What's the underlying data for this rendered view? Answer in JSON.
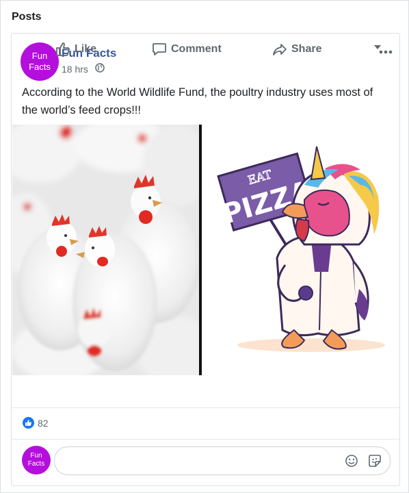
{
  "section": {
    "title": "Posts"
  },
  "post": {
    "avatar_line1": "Fun",
    "avatar_line2": "Facts",
    "author": "Fun Facts",
    "time": "18 hrs",
    "audience_icon": "globe-icon",
    "more_icon": "ellipsis-icon",
    "text": "According to the World Wildlife Fund, the poultry industry uses most of the world’s feed crops!!!",
    "image": {
      "left_alt": "white chickens",
      "sign_line1": "EAT",
      "sign_line2": "PIZZA"
    },
    "actions": {
      "like_label": "Like",
      "comment_label": "Comment",
      "share_label": "Share"
    },
    "reactions": {
      "count": "82"
    },
    "composer": {
      "avatar_line1": "Fun",
      "avatar_line2": "Facts",
      "placeholder": "",
      "emoji_icon": "smiley-icon",
      "sticker_icon": "sticker-icon"
    }
  },
  "colors": {
    "brand_purple": "#b40fdc",
    "author_blue": "#385898",
    "like_blue": "#1877f2",
    "muted": "#606770"
  }
}
